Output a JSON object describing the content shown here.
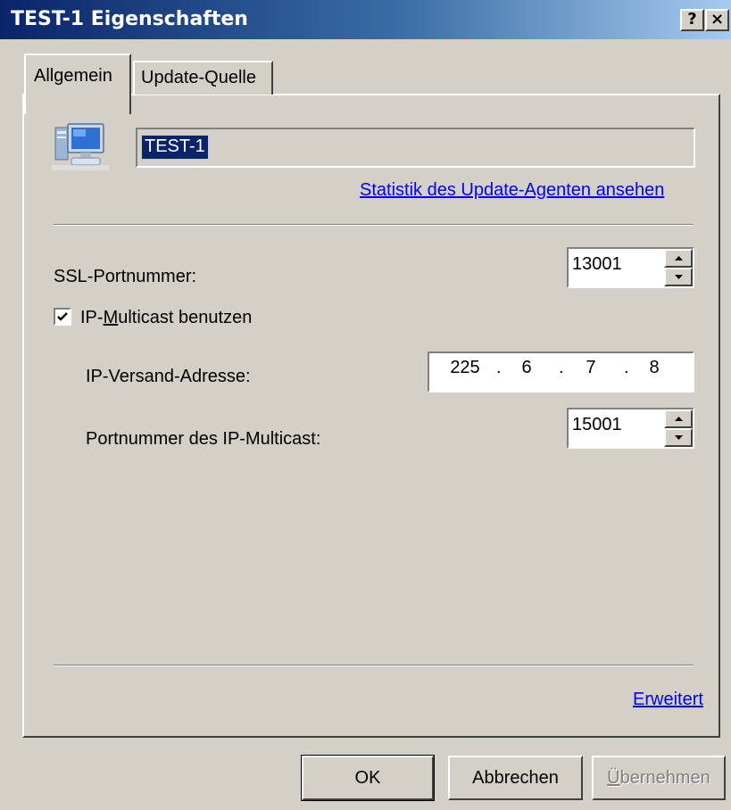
{
  "window": {
    "title": "TEST-1 Eigenschaften",
    "help_label": "?",
    "close_label": "×"
  },
  "tabs": [
    {
      "label": "Allgemein",
      "active": true
    },
    {
      "label": "Update-Quelle",
      "active": false
    }
  ],
  "general": {
    "computer_name": "TEST-1",
    "stats_link": "Statistik des Update-Agenten ansehen",
    "ssl_port_label": "SSL-Portnummer:",
    "ssl_port_value": "13001",
    "multicast_checkbox": {
      "label_pre": "IP-",
      "label_accel": "M",
      "label_post": "ulticast benutzen",
      "checked": true
    },
    "ip_address_label": "IP-Versand-Adresse:",
    "ip_address": [
      "225",
      "6",
      "7",
      "8"
    ],
    "multicast_port_label": "Portnummer des IP-Multicast:",
    "multicast_port_value": "15001",
    "advanced_link": "Erweitert"
  },
  "buttons": {
    "ok": "OK",
    "cancel": "Abbrechen",
    "apply_accel": "Ü",
    "apply_rest": "bernehmen"
  },
  "colors": {
    "titlebar_start": "#0a246a",
    "titlebar_end": "#a6caf0",
    "dialog_face": "#d4d0c8",
    "link": "#0000ff",
    "selection": "#0a246a"
  },
  "icons": {
    "computer": "computer-icon",
    "check": "checkmark-icon",
    "spin_up": "arrow-up-icon",
    "spin_down": "arrow-down-icon"
  }
}
